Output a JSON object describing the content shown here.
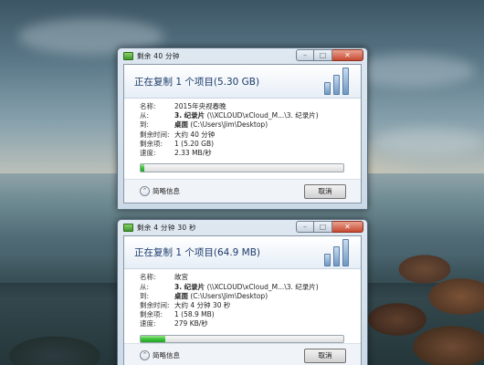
{
  "windows": [
    {
      "title": "剩余 40 分钟",
      "header": "正在复制 1 个项目(5.30 GB)",
      "rows": [
        {
          "label": "名称:",
          "value_bold": "",
          "value": "2015年央视春晚"
        },
        {
          "label": "从:",
          "value_bold": "3. 纪录片",
          "value": " (\\\\XCLOUD\\xCloud_M...\\3. 纪录片)"
        },
        {
          "label": "到:",
          "value_bold": "桌面",
          "value": " (C:\\Users\\Jim\\Desktop)"
        },
        {
          "label": "剩余时间:",
          "value_bold": "",
          "value": "大约 40 分钟"
        },
        {
          "label": "剩余项:",
          "value_bold": "",
          "value": "1 (5.20 GB)"
        },
        {
          "label": "速度:",
          "value_bold": "",
          "value": "2.33 MB/秒"
        }
      ],
      "progress": 0.02,
      "more_label": "简略信息",
      "cancel_label": "取消"
    },
    {
      "title": "剩余 4 分钟 30 秒",
      "header": "正在复制 1 个项目(64.9 MB)",
      "rows": [
        {
          "label": "名称:",
          "value_bold": "",
          "value": "故宫"
        },
        {
          "label": "从:",
          "value_bold": "3. 纪录片",
          "value": " (\\\\XCLOUD\\xCloud_M...\\3. 纪录片)"
        },
        {
          "label": "到:",
          "value_bold": "桌面",
          "value": " (C:\\Users\\Jim\\Desktop)"
        },
        {
          "label": "剩余时间:",
          "value_bold": "",
          "value": "大约 4 分钟 30 秒"
        },
        {
          "label": "剩余项:",
          "value_bold": "",
          "value": "1 (58.9 MB)"
        },
        {
          "label": "速度:",
          "value_bold": "",
          "value": "279 KB/秒"
        }
      ],
      "progress": 0.12,
      "more_label": "简略信息",
      "cancel_label": "取消"
    }
  ],
  "colors": {
    "header_text": "#1c3a6a",
    "progress_green": "#3cc23c",
    "close_red": "#c94a32"
  }
}
